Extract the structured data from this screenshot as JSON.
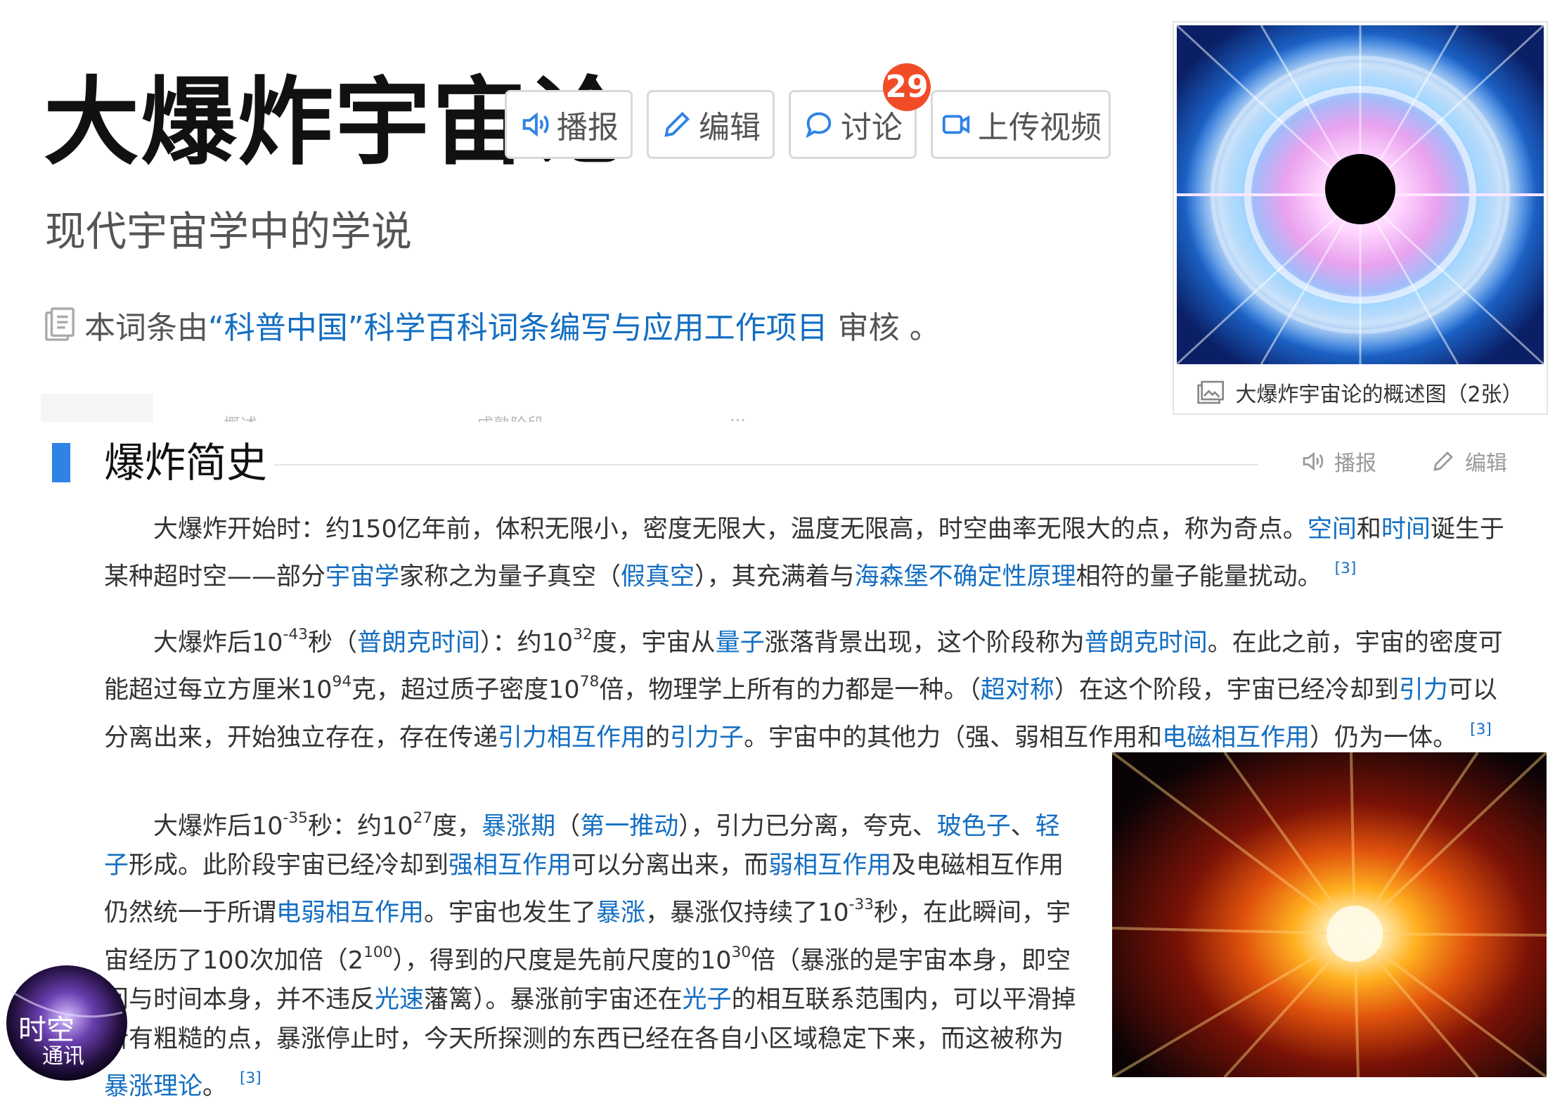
{
  "header": {
    "title": "大爆炸宇宙论",
    "subtitle": "现代宇宙学中的学说",
    "buttons": {
      "play": "播报",
      "edit": "编辑",
      "discuss": "讨论",
      "upload": "上传视频"
    },
    "discuss_count": "29",
    "review_prefix": "本词条由",
    "review_link": "“科普中国”科学百科词条编写与应用工作项目",
    "review_suffix": " 审核 。"
  },
  "summary_image": {
    "caption": "大爆炸宇宙论的概述图（2张）"
  },
  "tab_fragments": [
    "概述",
    "成熟阶段",
    "···"
  ],
  "section": {
    "title": "爆炸简史",
    "actions": {
      "play": "播报",
      "edit": "编辑"
    }
  },
  "p1": {
    "t1": "大爆炸开始时：约150亿年前，体积无限小，密度无限大，温度无限高，时空曲率无限大的点，称为奇点。",
    "l1": "空间",
    "t2": "和",
    "l2": "时间",
    "t3": "诞生于某种超时空——部分",
    "l3": "宇宙学",
    "t4": "家称之为量子真空（",
    "l4": "假真空",
    "t5": "），其充满着与",
    "l5": "海森堡不确定性原理",
    "t6": "相符的量子能量扰动。",
    "ref": "[3]"
  },
  "p2": {
    "t1": "大爆炸后10",
    "s1": "-43",
    "t2": "秒（",
    "l1": "普朗克时间",
    "t3": "）：约10",
    "s2": "32",
    "t4": "度，宇宙从",
    "l2": "量子",
    "t5": "涨落背景出现，这个阶段称为",
    "l3": "普朗克时间",
    "t6": "。在此之前，宇宙的密度可能超过每立方厘米10",
    "s3": "94",
    "t7": "克，超过质子密度10",
    "s4": "78",
    "t8": "倍，物理学上所有的力都是一种。（",
    "l4": "超对称",
    "t9": "）在这个阶段，宇宙已经冷却到",
    "l5": "引力",
    "t10": "可以分离出来，开始独立存在，存在传递",
    "l6": "引力相互作用",
    "t11": "的",
    "l7": "引力子",
    "t12": "。宇宙中的其他力（强、弱相互作用和",
    "l8": "电磁相互作用",
    "t13": "）仍为一体。",
    "ref": "[3]"
  },
  "p3": {
    "t1": "大爆炸后10",
    "s1": "-35",
    "t2": "秒：约10",
    "s2": "27",
    "t3": "度，",
    "l1": "暴涨期",
    "t4": "（",
    "l2": "第一推动",
    "t5": "），引力已分离，夸克、",
    "l3": "玻色子",
    "t6": "、",
    "l4": "轻子",
    "t7": "形成。此阶段宇宙已经冷却到",
    "l5": "强相互作用",
    "t8": "可以分离出来，而",
    "l6": "弱相互作用",
    "t9": "及电磁相互作用仍然统一于所谓",
    "l7": "电弱相互作用",
    "t10": "。宇宙也发生了",
    "l8": "暴涨",
    "t11": "，暴涨仅持续了10",
    "s3": "-33",
    "t12": "秒，在此瞬间，宇宙经历了100次加倍（2",
    "s4": "100",
    "t13": "），得到的尺度是先前尺度的10",
    "s5": "30",
    "t14": "倍（暴涨的是宇宙本身，即空间与时间本身，并不违反",
    "l9": "光速",
    "t15": "藩篱）。暴涨前宇宙还在",
    "l10": "光子",
    "t16": "的相互联系范围内，可以平滑掉所有粗糙的点，暴涨停止时，今天所探测的东西已经在各自小区域稳定下来，而这被称为",
    "l11": "暴涨理论",
    "t17": "。",
    "ref": "[3]"
  },
  "watermark": {
    "line1": "时空",
    "line2": "通讯"
  },
  "colors": {
    "link": "#136ec2",
    "accent": "#2f83e4",
    "badge": "#f24c27"
  }
}
